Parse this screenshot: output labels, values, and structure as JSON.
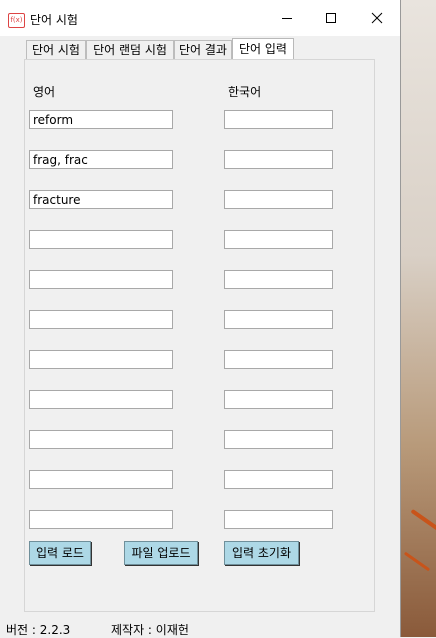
{
  "window": {
    "title": "단어 시험",
    "app_icon_text": "f(x)"
  },
  "tabs": [
    {
      "label": "단어 시험",
      "active": false
    },
    {
      "label": "단어 랜덤 시험",
      "active": false
    },
    {
      "label": "단어 결과",
      "active": false
    },
    {
      "label": "단어 입력",
      "active": true
    }
  ],
  "columns": {
    "english_label": "영어",
    "korean_label": "한국어"
  },
  "rows": [
    {
      "english": "reform",
      "korean": ""
    },
    {
      "english": "frag, frac",
      "korean": ""
    },
    {
      "english": "fracture",
      "korean": ""
    },
    {
      "english": "",
      "korean": ""
    },
    {
      "english": "",
      "korean": ""
    },
    {
      "english": "",
      "korean": ""
    },
    {
      "english": "",
      "korean": ""
    },
    {
      "english": "",
      "korean": ""
    },
    {
      "english": "",
      "korean": ""
    },
    {
      "english": "",
      "korean": ""
    },
    {
      "english": "",
      "korean": ""
    }
  ],
  "buttons": {
    "load": "입력 로드",
    "upload": "파일 업로드",
    "reset": "입력 초기화"
  },
  "status": {
    "version": "버전 : 2.2.3",
    "author": "제작자 : 이재헌"
  },
  "colors": {
    "button_bg": "#add8e6",
    "window_bg": "#f0f0f0"
  }
}
